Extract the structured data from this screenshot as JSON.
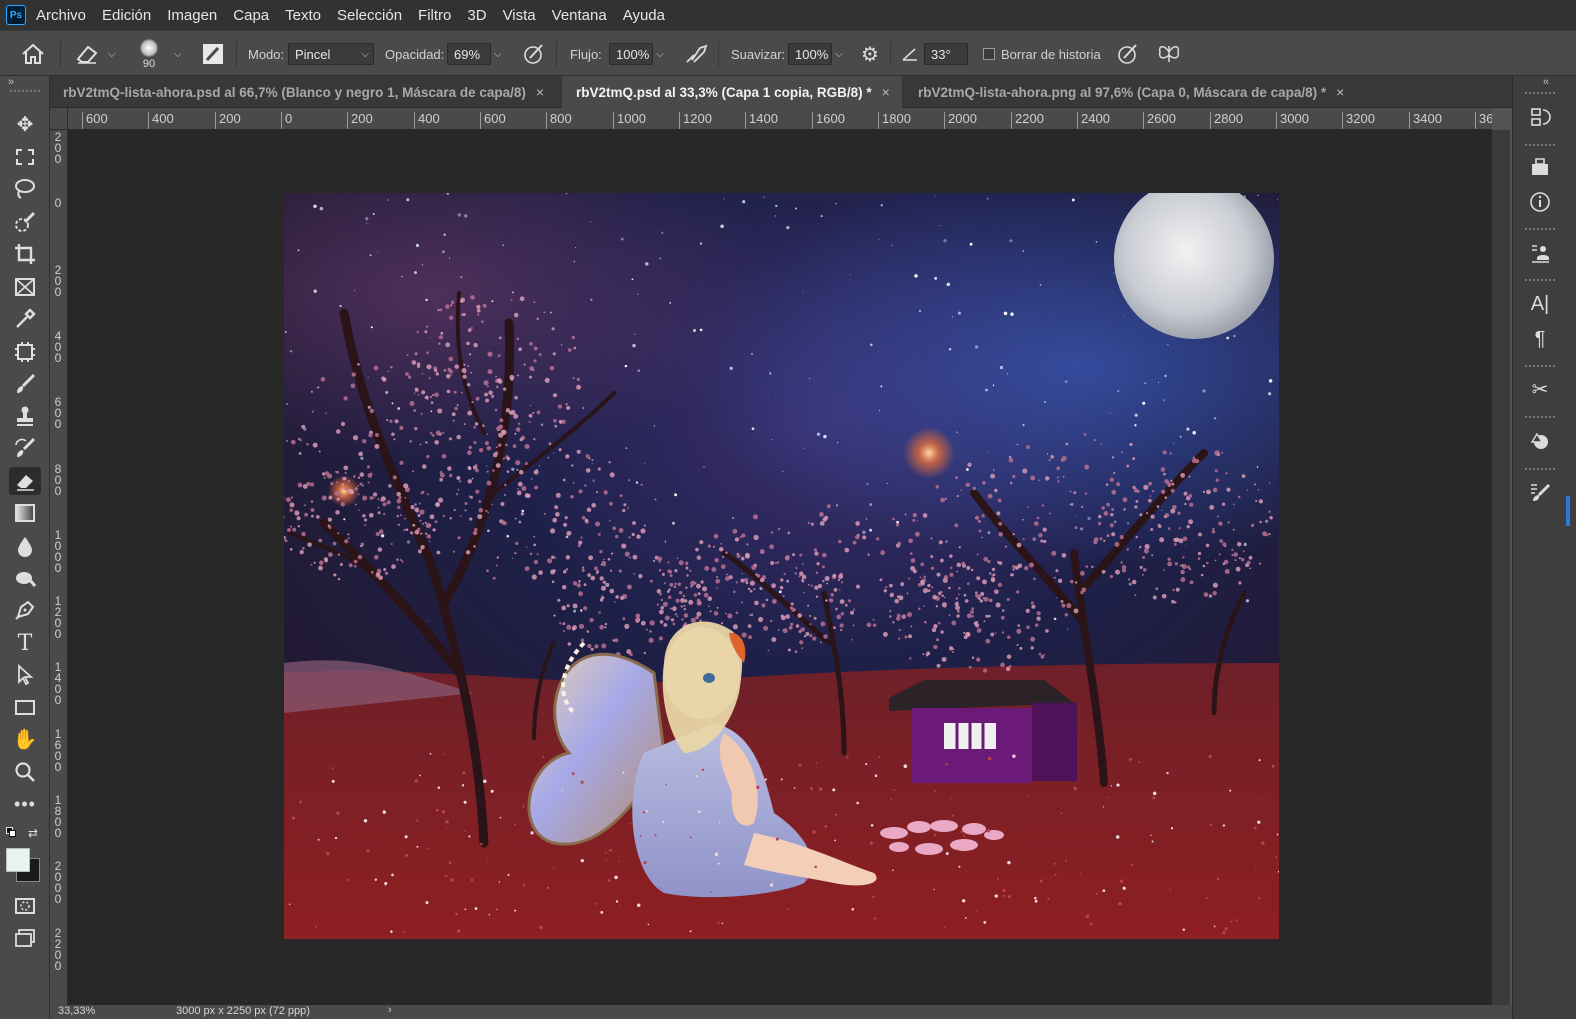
{
  "app": {
    "logo": "Ps",
    "menu": [
      "Archivo",
      "Edición",
      "Imagen",
      "Capa",
      "Texto",
      "Selección",
      "Filtro",
      "3D",
      "Vista",
      "Ventana",
      "Ayuda"
    ]
  },
  "options": {
    "brush_size": "90",
    "mode_label": "Modo:",
    "mode_value": "Pincel",
    "opacity_label": "Opacidad:",
    "opacity_value": "69%",
    "flow_label": "Flujo:",
    "flow_value": "100%",
    "smooth_label": "Suavizar:",
    "smooth_value": "100%",
    "angle_value": "33°",
    "erase_history_label": "Borrar de historia"
  },
  "tabs": [
    {
      "label": "rbV2tmQ-lista-ahora.psd al 66,7% (Blanco y negro 1, Máscara de capa/8)",
      "close": "×"
    },
    {
      "label": "rbV2tmQ.psd al 33,3% (Capa 1 copia, RGB/8) *",
      "close": "×",
      "active": true
    },
    {
      "label": "rbV2tmQ-lista-ahora.png al 97,6% (Capa 0, Máscara de capa/8) *",
      "close": "×"
    }
  ],
  "ruler_h": [
    "600",
    "400",
    "200",
    "0",
    "200",
    "400",
    "600",
    "800",
    "1000",
    "1200",
    "1400",
    "1600",
    "1800",
    "2000",
    "2200",
    "2400",
    "2600",
    "2800",
    "3000",
    "3200",
    "3400",
    "36"
  ],
  "ruler_v": [
    "200",
    "0",
    "200",
    "400",
    "600",
    "800",
    "1000",
    "1200",
    "1400",
    "1600",
    "1800",
    "2000",
    "2200"
  ],
  "status": {
    "zoom": "33,33%",
    "doc_size": "3000 px x 2250 px (72 ppp)"
  },
  "colors": {
    "foreground": "#e8f4ee",
    "background": "#1a1a1a",
    "accent": "#31a8ff"
  },
  "tools": [
    "move-icon",
    "marquee-icon",
    "lasso-icon",
    "quick-select-icon",
    "crop-icon",
    "frame-icon",
    "eyedropper-icon",
    "patch-icon",
    "brush-icon",
    "stamp-icon",
    "history-brush-icon",
    "eraser-icon",
    "gradient-icon",
    "blur-icon",
    "dodge-icon",
    "pen-icon",
    "type-icon",
    "path-select-icon",
    "rectangle-icon",
    "hand-icon",
    "zoom-icon",
    "more-icon"
  ],
  "right_panels": [
    "history-icon",
    "3d-icon",
    "info-icon",
    "layer-comps-icon",
    "character-icon",
    "paragraph-icon",
    "tool-presets-icon",
    "shapes-icon",
    "brush-settings-icon"
  ]
}
